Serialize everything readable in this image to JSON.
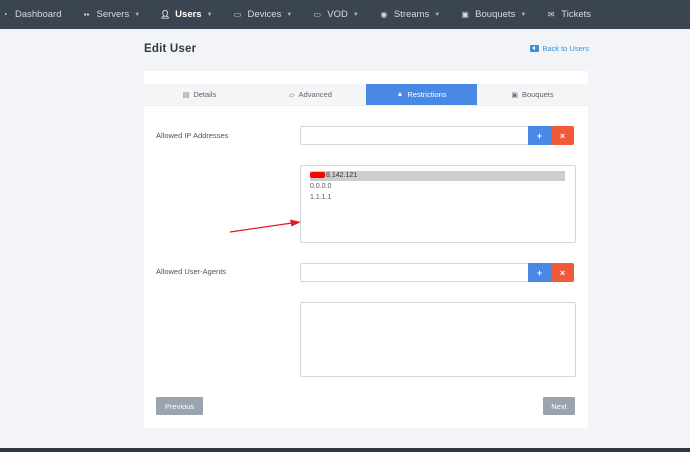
{
  "nav": {
    "items": [
      {
        "label": "Dashboard",
        "icon": "dashboard-icon",
        "caret": false,
        "active": false
      },
      {
        "label": "Servers",
        "icon": "server-icon",
        "caret": true,
        "active": false
      },
      {
        "label": "Users",
        "icon": "user-icon",
        "caret": true,
        "active": true
      },
      {
        "label": "Devices",
        "icon": "monitor-icon",
        "caret": true,
        "active": false
      },
      {
        "label": "VOD",
        "icon": "video-icon",
        "caret": true,
        "active": false
      },
      {
        "label": "Streams",
        "icon": "play-circle-icon",
        "caret": true,
        "active": false
      },
      {
        "label": "Bouquets",
        "icon": "gift-icon",
        "caret": true,
        "active": false
      },
      {
        "label": "Tickets",
        "icon": "envelope-icon",
        "caret": false,
        "active": false
      }
    ]
  },
  "header": {
    "title": "Edit User",
    "back_label": "Back to Users"
  },
  "tabs": [
    {
      "label": "Details",
      "icon": "card-icon",
      "active": false
    },
    {
      "label": "Advanced",
      "icon": "folder-icon",
      "active": false
    },
    {
      "label": "Restrictions",
      "icon": "warning-icon",
      "active": true
    },
    {
      "label": "Bouquets",
      "icon": "gift-icon",
      "active": false
    }
  ],
  "restrictions": {
    "ip_label": "Allowed IP Addresses",
    "ip_input_value": "",
    "ip_list": [
      "8.142.121",
      "0.0.0.0",
      "1.1.1.1"
    ],
    "agent_label": "Allowed User-Agents",
    "agent_input_value": "",
    "agent_list": [],
    "add_symbol": "+",
    "remove_symbol": "×"
  },
  "footer": {
    "previous_label": "Previous",
    "next_label": "Next"
  },
  "colors": {
    "navbar": "#3b4451",
    "accent": "#4a88e5",
    "danger": "#f2593b",
    "annotation": "#e8191e"
  }
}
